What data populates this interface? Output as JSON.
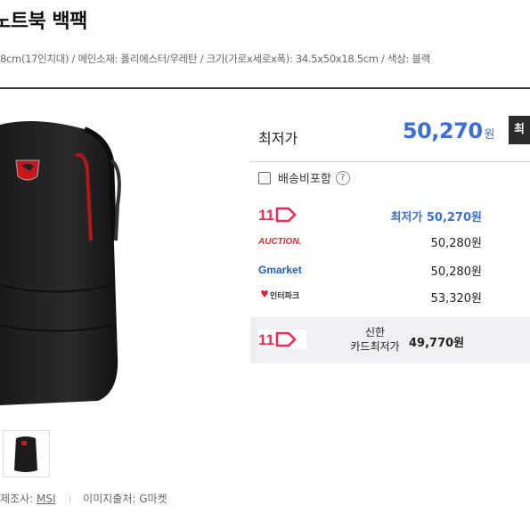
{
  "product": {
    "title": "노트북 백팩",
    "specs": "8cm(17인치대) / 메인소재: 폴리에스터/우레탄 / 크기(가로x세로x폭): 34.5x50x18.5cm / 색상: 블랙"
  },
  "meta": {
    "maker_label": "제조사:",
    "maker": "MSI",
    "image_source": "이미지출처: G마켓"
  },
  "price": {
    "lowest_label": "최저가",
    "lowest_value": "50,270",
    "won": "원",
    "cut_button": "최"
  },
  "shipping": {
    "label": "배송비포함",
    "help": "?"
  },
  "shops": [
    {
      "name": "11번가",
      "logo_text": "11",
      "price": "최저가 50,270원",
      "best": true
    },
    {
      "name": "옥션",
      "logo_text": "AUCTION.",
      "price": "50,280원",
      "best": false
    },
    {
      "name": "G마켓",
      "logo_text": "Gmarket",
      "price": "50,280원",
      "best": false
    },
    {
      "name": "인터파크",
      "logo_text": "인터파크",
      "price": "53,320원",
      "best": false
    }
  ],
  "card_offer": {
    "logo_text": "11",
    "card_name_line1": "신한",
    "card_name_line2": "카드최저가",
    "price": "49,770원"
  },
  "colors": {
    "accent_blue": "#3b6fd6",
    "st11_red": "#ee2b56",
    "auction_red": "#e8262a",
    "gmarket_green": "#2aa136",
    "gmarket_blue": "#1a5fd0",
    "interpark_red": "#e5213b"
  }
}
